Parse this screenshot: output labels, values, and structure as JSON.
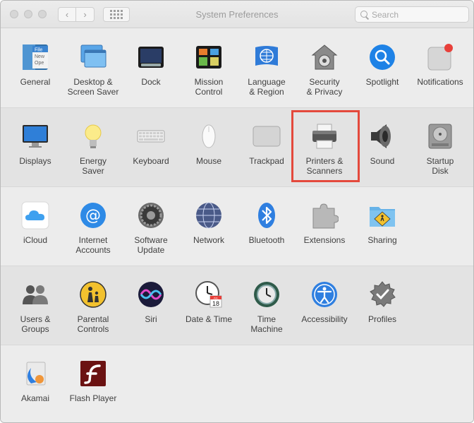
{
  "window": {
    "title": "System Preferences"
  },
  "toolbar": {
    "back": "‹",
    "forward": "›"
  },
  "search": {
    "placeholder": "Search"
  },
  "rows": [
    [
      {
        "id": "general",
        "label": "General",
        "icon_text": [
          "File",
          "New",
          "Ope"
        ]
      },
      {
        "id": "desktop",
        "label": "Desktop &\nScreen Saver"
      },
      {
        "id": "dock",
        "label": "Dock"
      },
      {
        "id": "mission",
        "label": "Mission\nControl"
      },
      {
        "id": "language",
        "label": "Language\n& Region"
      },
      {
        "id": "security",
        "label": "Security\n& Privacy"
      },
      {
        "id": "spotlight",
        "label": "Spotlight"
      },
      {
        "id": "notifications",
        "label": "Notifications"
      }
    ],
    [
      {
        "id": "displays",
        "label": "Displays"
      },
      {
        "id": "energy",
        "label": "Energy\nSaver"
      },
      {
        "id": "keyboard",
        "label": "Keyboard"
      },
      {
        "id": "mouse",
        "label": "Mouse"
      },
      {
        "id": "trackpad",
        "label": "Trackpad"
      },
      {
        "id": "printers",
        "label": "Printers &\nScanners"
      },
      {
        "id": "sound",
        "label": "Sound"
      },
      {
        "id": "startup",
        "label": "Startup\nDisk"
      }
    ],
    [
      {
        "id": "icloud",
        "label": "iCloud"
      },
      {
        "id": "internet",
        "label": "Internet\nAccounts"
      },
      {
        "id": "software",
        "label": "Software\nUpdate"
      },
      {
        "id": "network",
        "label": "Network"
      },
      {
        "id": "bluetooth",
        "label": "Bluetooth"
      },
      {
        "id": "extensions",
        "label": "Extensions"
      },
      {
        "id": "sharing",
        "label": "Sharing"
      }
    ],
    [
      {
        "id": "users",
        "label": "Users &\nGroups"
      },
      {
        "id": "parental",
        "label": "Parental\nControls"
      },
      {
        "id": "siri",
        "label": "Siri"
      },
      {
        "id": "datetime",
        "label": "Date & Time",
        "icon_text": [
          "JUL",
          "18"
        ]
      },
      {
        "id": "timemachine",
        "label": "Time\nMachine"
      },
      {
        "id": "accessibility",
        "label": "Accessibility"
      },
      {
        "id": "profiles",
        "label": "Profiles"
      }
    ],
    [
      {
        "id": "akamai",
        "label": "Akamai"
      },
      {
        "id": "flash",
        "label": "Flash Player"
      }
    ]
  ],
  "colors": {
    "highlight": "#e4493c",
    "accent_blue": "#1e82e6"
  }
}
